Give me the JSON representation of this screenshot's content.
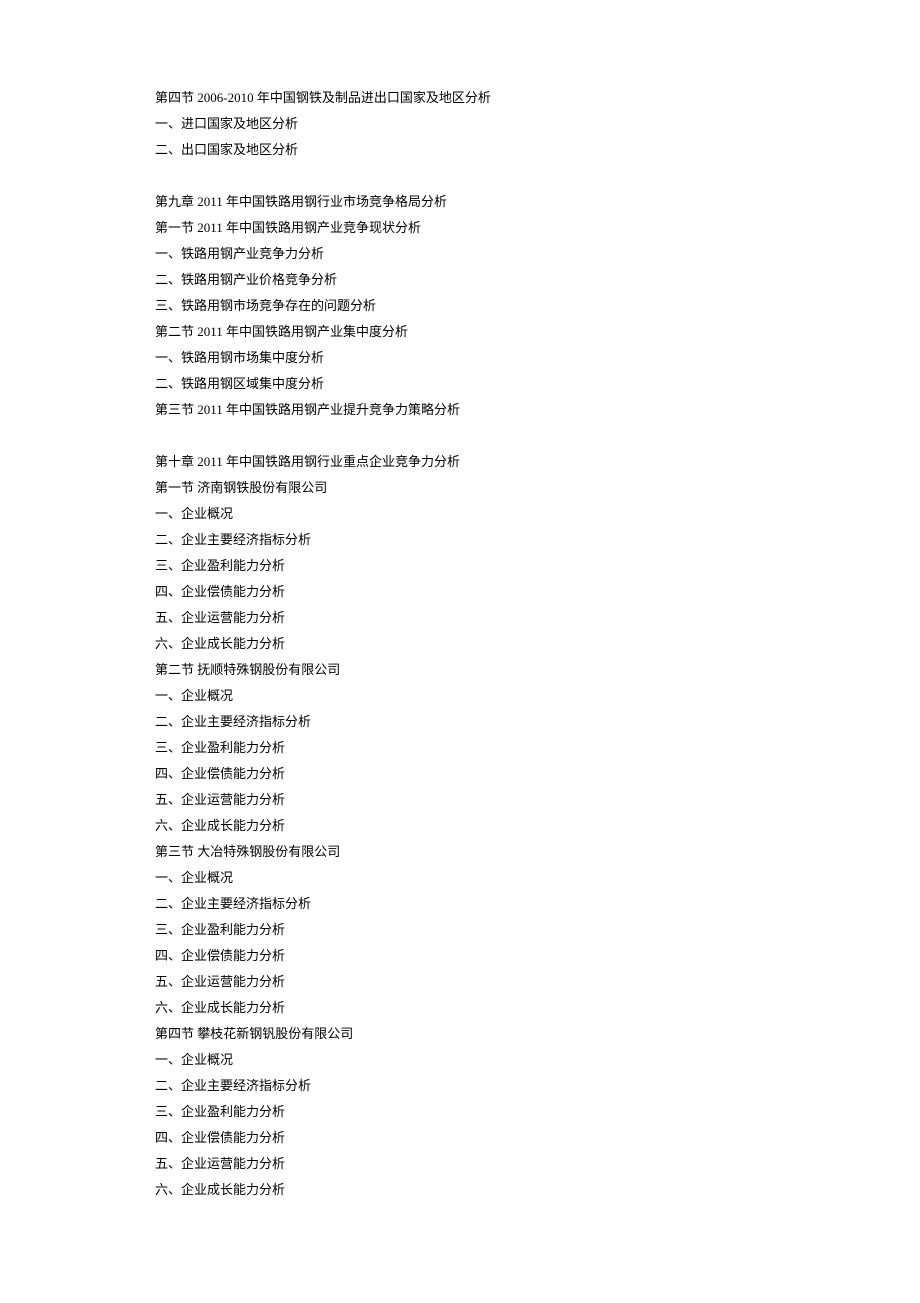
{
  "block1": {
    "l1": "第四节 2006-2010 年中国钢铁及制品进出口国家及地区分析",
    "l2": "一、进口国家及地区分析",
    "l3": "二、出口国家及地区分析"
  },
  "block2": {
    "l1": "第九章  2011 年中国铁路用钢行业市场竞争格局分析",
    "l2": "第一节  2011 年中国铁路用钢产业竞争现状分析",
    "l3": "一、铁路用钢产业竞争力分析",
    "l4": "二、铁路用钢产业价格竞争分析",
    "l5": "三、铁路用钢市场竞争存在的问题分析",
    "l6": "第二节  2011 年中国铁路用钢产业集中度分析",
    "l7": "一、铁路用钢市场集中度分析",
    "l8": "二、铁路用钢区域集中度分析",
    "l9": "第三节  2011 年中国铁路用钢产业提升竞争力策略分析"
  },
  "block3": {
    "l1": "第十章 2011 年中国铁路用钢行业重点企业竞争力分析",
    "l2": "第一节 济南钢铁股份有限公司",
    "l3": "一、企业概况",
    "l4": "二、企业主要经济指标分析",
    "l5": "三、企业盈利能力分析",
    "l6": "四、企业偿债能力分析",
    "l7": "五、企业运营能力分析",
    "l8": "六、企业成长能力分析",
    "l9": "第二节  抚顺特殊钢股份有限公司",
    "l10": "一、企业概况",
    "l11": "二、企业主要经济指标分析",
    "l12": "三、企业盈利能力分析",
    "l13": "四、企业偿债能力分析",
    "l14": "五、企业运营能力分析",
    "l15": "六、企业成长能力分析",
    "l16": "第三节  大冶特殊钢股份有限公司",
    "l17": "一、企业概况",
    "l18": "二、企业主要经济指标分析",
    "l19": "三、企业盈利能力分析",
    "l20": "四、企业偿债能力分析",
    "l21": "五、企业运营能力分析",
    "l22": "六、企业成长能力分析",
    "l23": "第四节  攀枝花新钢钒股份有限公司",
    "l24": "一、企业概况",
    "l25": "二、企业主要经济指标分析",
    "l26": "三、企业盈利能力分析",
    "l27": "四、企业偿债能力分析",
    "l28": "五、企业运营能力分析",
    "l29": "六、企业成长能力分析"
  }
}
